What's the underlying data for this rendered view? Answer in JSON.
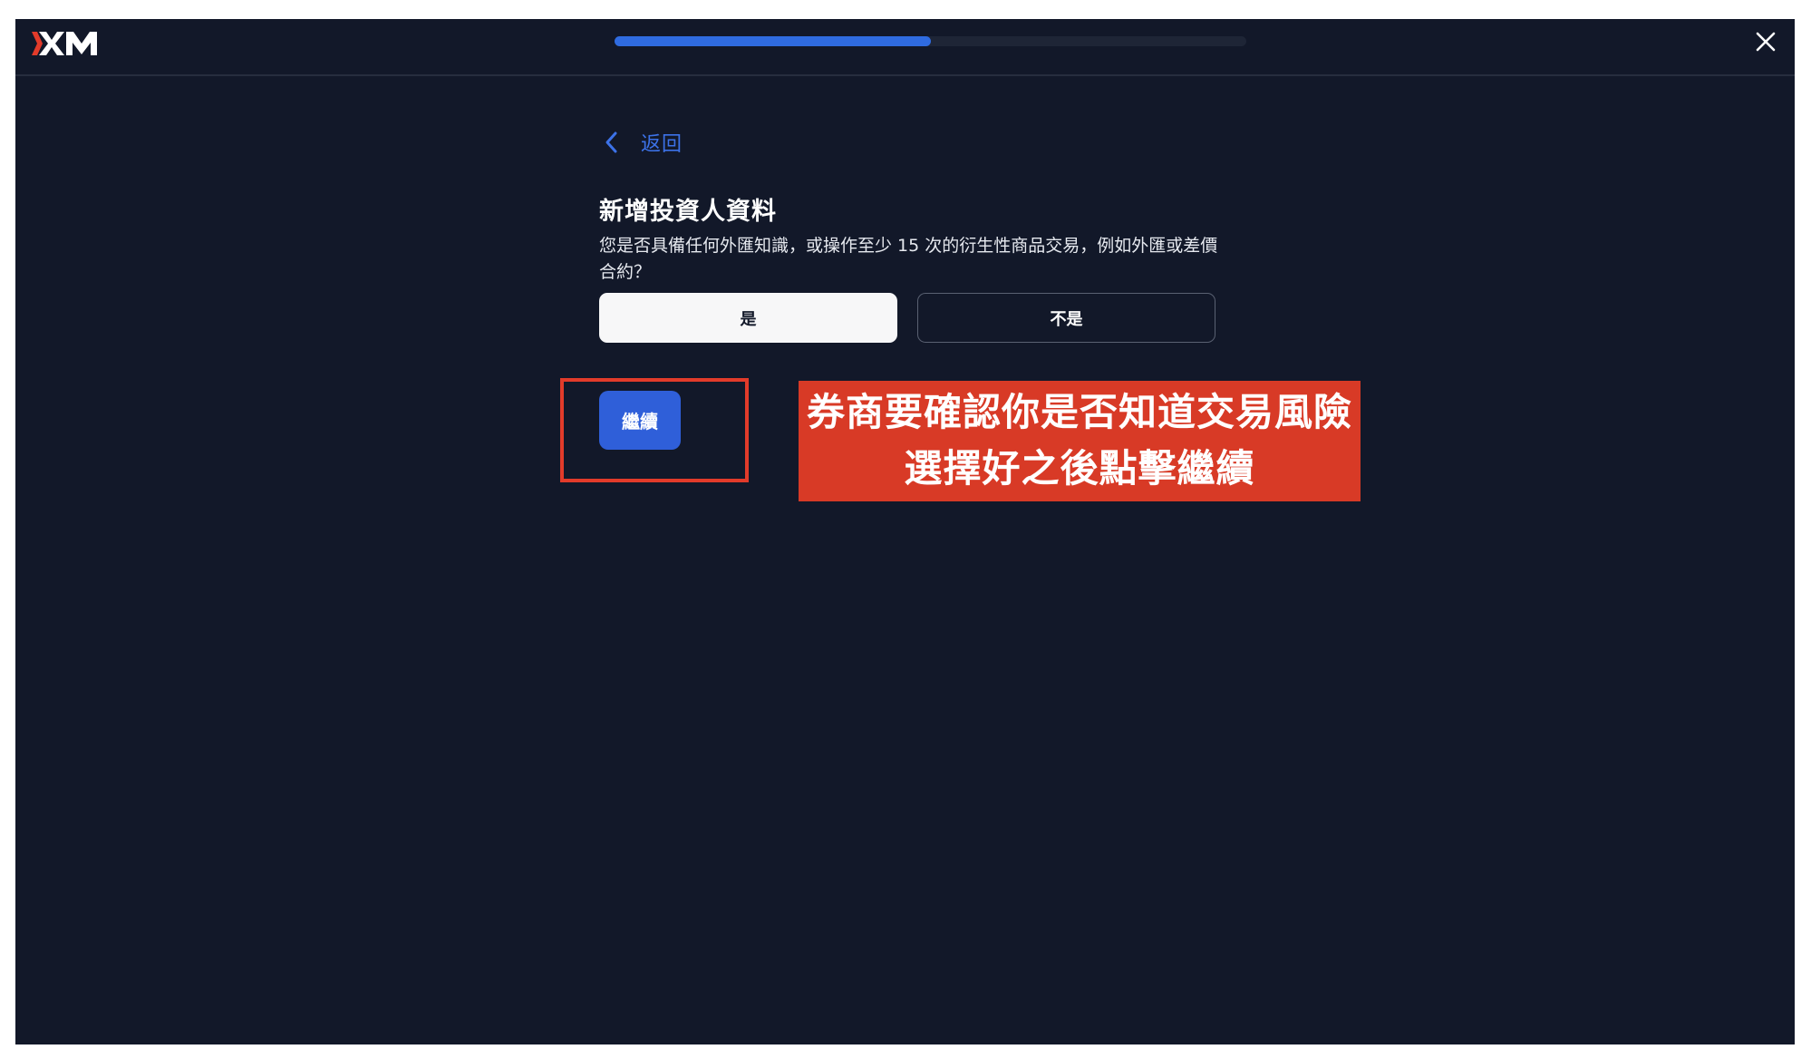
{
  "header": {
    "logo_text": "XM",
    "progress_fraction": 0.5,
    "colors": {
      "background": "#121829",
      "progress_fill": "#2f6be0",
      "progress_track": "#1e2536"
    }
  },
  "nav": {
    "back_label": "返回"
  },
  "form": {
    "title": "新增投資人資料",
    "question": "您是否具備任何外匯知識，或操作至少 15 次的衍生性商品交易，例如外匯或差價合約？",
    "options": [
      {
        "label": "是",
        "selected": true
      },
      {
        "label": "不是",
        "selected": false
      }
    ],
    "continue_label": "繼續"
  },
  "annotation": {
    "line1": "券商要確認你是否知道交易風險",
    "line2": "選擇好之後點擊繼續",
    "color": "#d83a26"
  }
}
